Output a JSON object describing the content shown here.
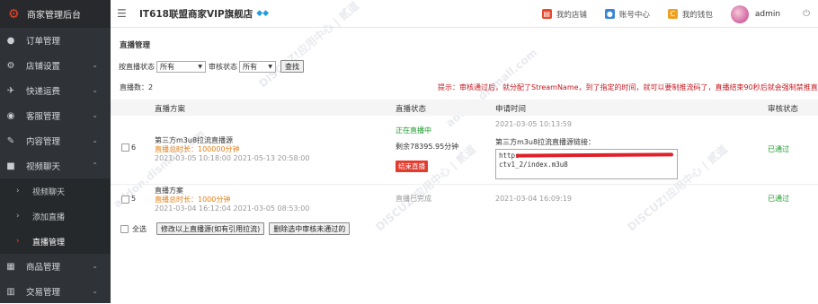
{
  "sidebar": {
    "brand": "商家管理后台",
    "items": [
      {
        "label": "订单管理",
        "icon": "user-icon",
        "glyph": "👤"
      },
      {
        "label": "店铺设置",
        "icon": "gear-icon",
        "glyph": "⚙"
      },
      {
        "label": "快递运费",
        "icon": "plane-icon",
        "glyph": "✈"
      },
      {
        "label": "客服管理",
        "icon": "chat-icon",
        "glyph": "💬"
      },
      {
        "label": "内容管理",
        "icon": "edit-icon",
        "glyph": "✎"
      },
      {
        "label": "视频聊天",
        "icon": "video-icon",
        "glyph": "■"
      }
    ],
    "sub_items": [
      {
        "label": "视频聊天"
      },
      {
        "label": "添加直播"
      },
      {
        "label": "直播管理"
      }
    ],
    "items_after": [
      {
        "label": "商品管理",
        "icon": "grid-icon",
        "glyph": "▦"
      },
      {
        "label": "交易管理",
        "icon": "chart-icon",
        "glyph": "▥"
      }
    ]
  },
  "topbar": {
    "store_name": "IT618联盟商家VIP旗舰店",
    "links": [
      {
        "label": "我的店铺",
        "color": "#e8472c",
        "glyph": "▤"
      },
      {
        "label": "账号中心",
        "color": "#3a86d6",
        "glyph": "👤"
      },
      {
        "label": "我的钱包",
        "color": "#f0a020",
        "glyph": "C"
      }
    ],
    "user": "admin"
  },
  "main": {
    "page_title": "直播管理",
    "filter": {
      "live_status_label": "按直播状态",
      "live_status_value": "所有",
      "review_status_label": "审核状态",
      "review_status_value": "所有",
      "search_button": "查找"
    },
    "count_label": "直播数：2",
    "tip": "提示：审核通过后，就分配了StreamName，到了指定的时间，就可以要制推流码了，直播结束90秒后就会强制禁推直播流",
    "columns": [
      "直播方案",
      "直播状态",
      "申请时间",
      "审核状态"
    ],
    "rows": [
      {
        "id": "6",
        "plan_name": "第三方m3u8拉流直播源",
        "duration": "直播总时长：100000分钟",
        "period": "2021-03-05 10:18:00 2021-05-13 20:58:00",
        "status": "正在直播中",
        "remaining": "剩余78395.95分钟",
        "end_button": "结束直播",
        "apply_time": "2021-03-05 10:13:59",
        "source_label": "第三方m3u8拉流直播源链接：",
        "source_line1": "https",
        "source_line2": "ctv1_2/index.m3u8",
        "review": "已通过"
      },
      {
        "id": "5",
        "plan_name": "直播方案",
        "duration": "直播总时长：1000分钟",
        "period": "2021-03-04 16:12:04 2021-03-05 08:53:00",
        "status": "直播已完成",
        "apply_time": "2021-03-04 16:09:19",
        "review": "已通过"
      }
    ],
    "select_all": "全选",
    "modify_button": "修改以上直播源(如有引用拉流)",
    "delete_button": "删除选中审核未通过的"
  },
  "watermark": [
    "DISCUZ!应用中心 | 贰道",
    "addon.dismall.com"
  ]
}
